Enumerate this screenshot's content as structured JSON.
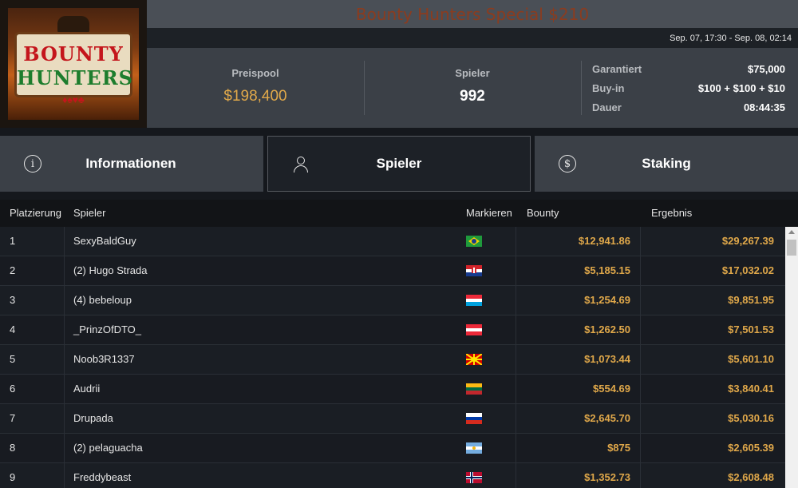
{
  "header": {
    "title": "Bounty Hunters Special $210",
    "date_range": "Sep. 07, 17:30 - Sep. 08, 02:14",
    "logo_line1": "BOUNTY",
    "logo_line2": "HUNTERS"
  },
  "stats": {
    "prizepool_label": "Preispool",
    "prizepool_value": "$198,400",
    "players_label": "Spieler",
    "players_value": "992",
    "details": [
      {
        "key": "Garantiert",
        "value": "$75,000"
      },
      {
        "key": "Buy-in",
        "value": "$100 + $100 + $10"
      },
      {
        "key": "Dauer",
        "value": "08:44:35"
      }
    ]
  },
  "tabs": {
    "info": "Informationen",
    "players": "Spieler",
    "staking": "Staking"
  },
  "table": {
    "headers": {
      "rank": "Platzierung",
      "player": "Spieler",
      "flag": "Markieren",
      "bounty": "Bounty",
      "result": "Ergebnis"
    },
    "rows": [
      {
        "rank": "1",
        "player": "SexyBaldGuy",
        "country": "brazil",
        "bounty": "$12,941.86",
        "result": "$29,267.39"
      },
      {
        "rank": "2",
        "player": "(2) Hugo Strada",
        "country": "croatia",
        "bounty": "$5,185.15",
        "result": "$17,032.02"
      },
      {
        "rank": "3",
        "player": "(4) bebeloup",
        "country": "luxembourg",
        "bounty": "$1,254.69",
        "result": "$9,851.95"
      },
      {
        "rank": "4",
        "player": "_PrinzOfDTO_",
        "country": "austria",
        "bounty": "$1,262.50",
        "result": "$7,501.53"
      },
      {
        "rank": "5",
        "player": "Noob3R1337",
        "country": "north-macedonia",
        "bounty": "$1,073.44",
        "result": "$5,601.10"
      },
      {
        "rank": "6",
        "player": "Audrii",
        "country": "lithuania",
        "bounty": "$554.69",
        "result": "$3,840.41"
      },
      {
        "rank": "7",
        "player": "Drupada",
        "country": "russia",
        "bounty": "$2,645.70",
        "result": "$5,030.16"
      },
      {
        "rank": "8",
        "player": "(2) pelaguacha",
        "country": "argentina",
        "bounty": "$875",
        "result": "$2,605.39"
      },
      {
        "rank": "9",
        "player": "Freddybeast",
        "country": "norway",
        "bounty": "$1,352.73",
        "result": "$2,608.48"
      }
    ]
  },
  "colors": {
    "accent_gold": "#e0a84a",
    "title_color": "#8b3c1f",
    "panel": "#3b4047",
    "background": "#15181d"
  }
}
